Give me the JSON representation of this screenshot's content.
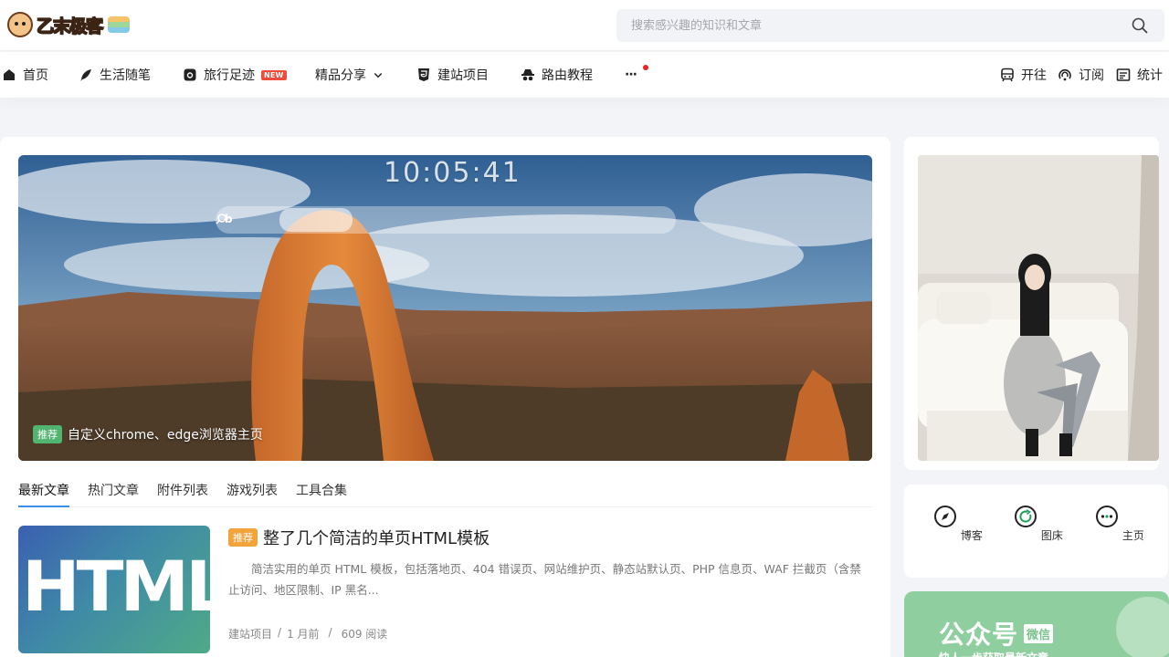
{
  "site": {
    "logo_text": "乙末极客"
  },
  "search": {
    "placeholder": "搜索感兴趣的知识和文章"
  },
  "nav": {
    "items": [
      {
        "label": "首页",
        "icon": "home-icon"
      },
      {
        "label": "生活随笔",
        "icon": "feather-icon"
      },
      {
        "label": "旅行足迹",
        "icon": "camera-icon",
        "badge": "NEW"
      },
      {
        "label": "精品分享",
        "icon": "chevron-down-icon"
      },
      {
        "label": "建站项目",
        "icon": "html5-icon"
      },
      {
        "label": "路由教程",
        "icon": "spy-icon"
      },
      {
        "label": "···",
        "icon": "more-icon"
      }
    ],
    "right": [
      {
        "label": "开往",
        "icon": "train-icon"
      },
      {
        "label": "订阅",
        "icon": "rss-icon"
      },
      {
        "label": "统计",
        "icon": "chart-icon"
      }
    ]
  },
  "banner": {
    "clock": "10:05:41",
    "tag": "推荐",
    "title": "自定义chrome、edge浏览器主页"
  },
  "tabs": [
    "最新文章",
    "热门文章",
    "附件列表",
    "游戏列表",
    "工具合集"
  ],
  "post": {
    "thumb_text": "HTML",
    "tag": "推荐",
    "title": "整了几个简洁的单页HTML模板",
    "excerpt": "简洁实用的单页 HTML 模板，包括落地页、404 错误页、网站维护页、静态站默认页、PHP 信息页、WAF 拦截页（含禁止访问、地区限制、IP 黑名...",
    "category": "建站项目",
    "sep": "/",
    "time": "1 月前",
    "views": "609 阅读"
  },
  "side_links": [
    {
      "label": "博客",
      "icon": "compass-icon"
    },
    {
      "label": "图床",
      "icon": "refresh-icon"
    },
    {
      "label": "主页",
      "icon": "more-circle-icon"
    }
  ],
  "wechat": {
    "title": "公众号",
    "tag": "微信",
    "subtitle": "快人一步获取最新文章"
  },
  "colors": {
    "accent": "#3d8ee8",
    "recommend_green": "#51b571",
    "recommend_orange": "#f2a33a",
    "new_badge": "#ef4b3a"
  }
}
